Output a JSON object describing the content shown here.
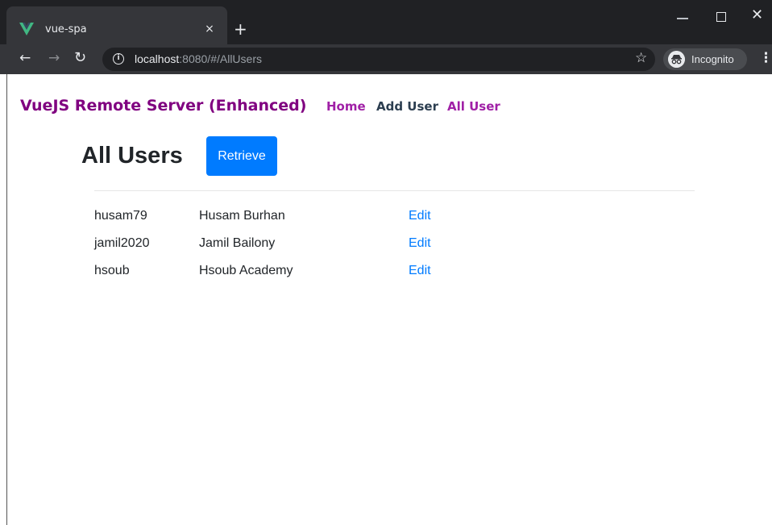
{
  "browser": {
    "tab_title": "vue-spa",
    "tab_close": "×",
    "new_tab": "+",
    "url_host": "localhost",
    "url_rest": ":8080/#/AllUsers",
    "incognito_label": "Incognito",
    "window_close": "✕",
    "icons": {
      "favicon": "vue-logo-icon",
      "back": "arrow-left-icon",
      "forward": "arrow-right-icon",
      "reload": "reload-icon",
      "info": "info-icon",
      "bookmark": "star-icon",
      "incognito": "incognito-icon",
      "menu": "kebab-menu-icon"
    }
  },
  "header": {
    "brand": "VueJS Remote Server (Enhanced)",
    "nav": [
      "Home",
      "Add User",
      "All User"
    ],
    "brand_color": "#800080",
    "link_color": "#a020a6"
  },
  "main": {
    "title": "All Users",
    "retrieve_label": "Retrieve",
    "accent": "#007bff",
    "users": [
      {
        "username": "husam79",
        "name": "Husam Burhan",
        "action": "Edit"
      },
      {
        "username": "jamil2020",
        "name": "Jamil Bailony",
        "action": "Edit"
      },
      {
        "username": "hsoub",
        "name": "Hsoub Academy",
        "action": "Edit"
      }
    ]
  }
}
